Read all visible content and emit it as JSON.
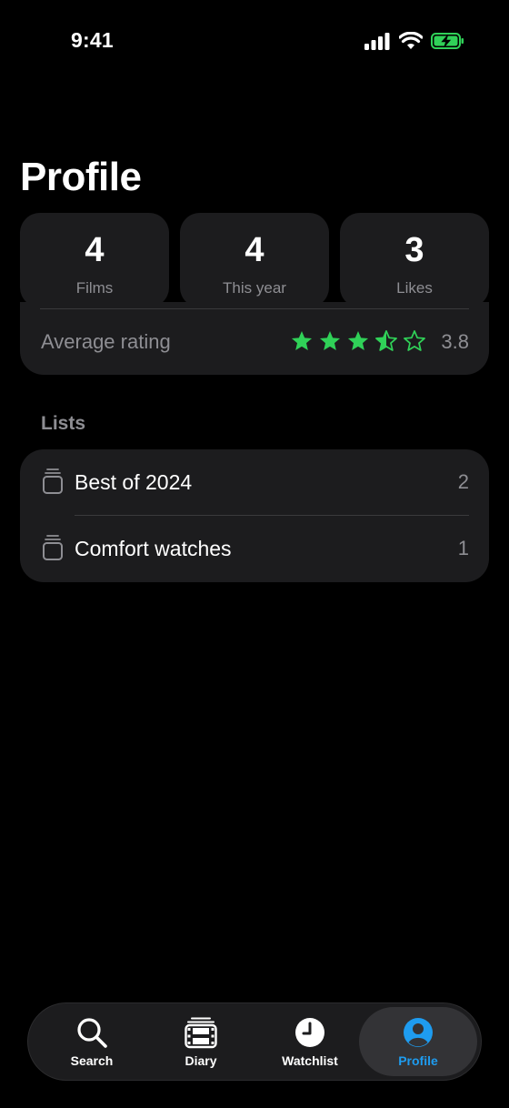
{
  "status_bar": {
    "time": "9:41"
  },
  "title": "Profile",
  "stats": [
    {
      "value": "4",
      "label": "Films"
    },
    {
      "value": "4",
      "label": "This year"
    },
    {
      "value": "3",
      "label": "Likes"
    }
  ],
  "rating": {
    "label": "Average rating",
    "value": "3.8",
    "stars_full": 3,
    "stars_half": 1,
    "stars_empty": 1
  },
  "lists_section": {
    "header": "Lists",
    "items": [
      {
        "name": "Best of 2024",
        "count": "2"
      },
      {
        "name": "Comfort watches",
        "count": "1"
      }
    ]
  },
  "tab_bar": {
    "tabs": [
      {
        "label": "Search",
        "icon": "magnifying-glass"
      },
      {
        "label": "Diary",
        "icon": "film-strip"
      },
      {
        "label": "Watchlist",
        "icon": "clock"
      },
      {
        "label": "Profile",
        "icon": "person-circle",
        "selected": true
      }
    ]
  },
  "colors": {
    "accent": "#1e9cf0",
    "star": "#30d158",
    "battery": "#30d158",
    "card": "#1c1c1e",
    "secondary_text": "#8e8e93"
  }
}
